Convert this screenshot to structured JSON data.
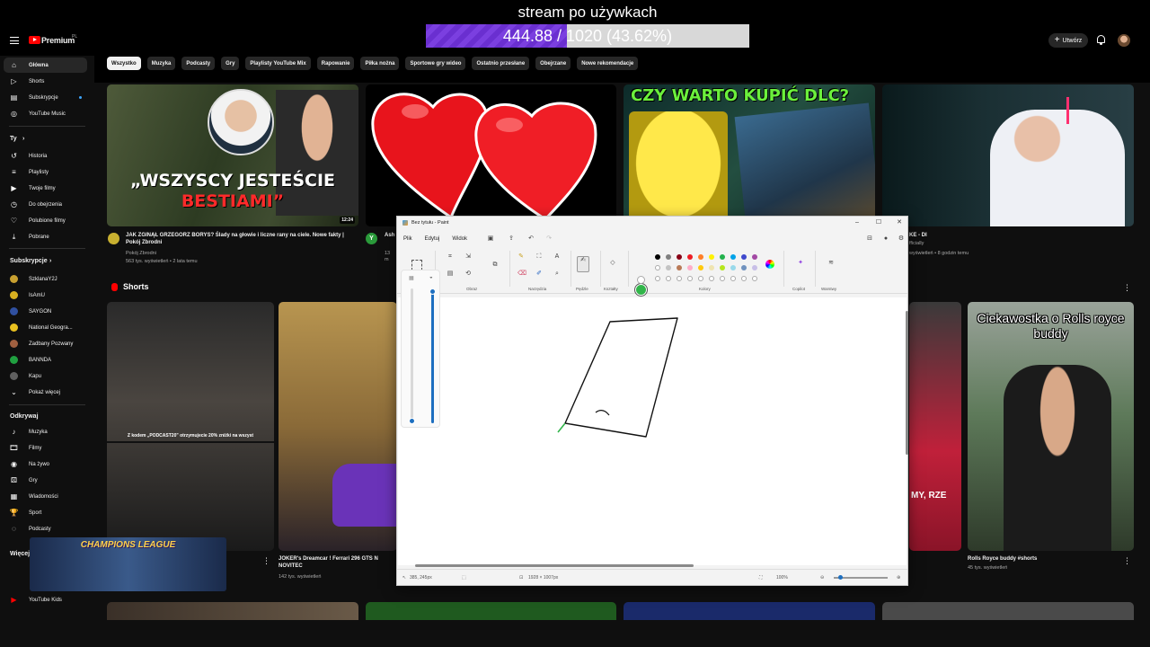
{
  "overlay": {
    "stream_title": "stream po używkach",
    "progress_text": "444.88 / 1020 (43.62%)",
    "progress_value": 444.88,
    "progress_max": 1020,
    "progress_fraction": 0.4362
  },
  "header": {
    "brand": "Premium",
    "region": "PL",
    "create_label": "Utwórz"
  },
  "chips": [
    "Wszystko",
    "Muzyka",
    "Podcasty",
    "Gry",
    "Playlisty YouTube Mix",
    "Rapowanie",
    "Piłka nożna",
    "Sportowe gry wideo",
    "Ostatnio przesłane",
    "Obejrzane",
    "Nowe rekomendacje"
  ],
  "sidebar": {
    "main": [
      {
        "label": "Główna",
        "icon": "home-icon"
      },
      {
        "label": "Shorts",
        "icon": "shorts-icon"
      },
      {
        "label": "Subskrypcje",
        "icon": "subscriptions-icon"
      },
      {
        "label": "YouTube Music",
        "icon": "youtube-music-icon"
      }
    ],
    "you_heading": "Ty",
    "you": [
      {
        "label": "Historia",
        "icon": "history-icon"
      },
      {
        "label": "Playlisty",
        "icon": "playlists-icon"
      },
      {
        "label": "Twoje filmy",
        "icon": "your-videos-icon"
      },
      {
        "label": "Do obejrzenia",
        "icon": "watch-later-icon"
      },
      {
        "label": "Polubione filmy",
        "icon": "liked-icon"
      },
      {
        "label": "Pobrane",
        "icon": "download-icon"
      }
    ],
    "subs_heading": "Subskrypcje",
    "subs": [
      {
        "label": "SzklanaY2J",
        "color": "#c8a030"
      },
      {
        "label": "IsAmU",
        "color": "#d8b020"
      },
      {
        "label": "SAYGON",
        "color": "#3050a0"
      },
      {
        "label": "National Geogra...",
        "color": "#e8c020"
      },
      {
        "label": "Zadbany Pozwany",
        "color": "#a06040"
      },
      {
        "label": "BANNDA",
        "color": "#20a040"
      },
      {
        "label": "Kapu",
        "color": "#606060"
      }
    ],
    "show_more": "Pokaż więcej",
    "explore_heading": "Odkrywaj",
    "explore": [
      {
        "label": "Muzyka",
        "icon": "music-icon"
      },
      {
        "label": "Filmy",
        "icon": "movies-icon"
      },
      {
        "label": "Na żywo",
        "icon": "live-icon"
      },
      {
        "label": "Gry",
        "icon": "gaming-icon"
      },
      {
        "label": "Wiadomości",
        "icon": "news-icon"
      },
      {
        "label": "Sport",
        "icon": "sport-icon"
      },
      {
        "label": "Podcasty",
        "icon": "podcasts-icon"
      }
    ],
    "more_heading": "Więcej",
    "youtube_kids": "YouTube Kids"
  },
  "videos": [
    {
      "thumb_caption_1": "„WSZYSCY JESTEŚCIE",
      "thumb_caption_2": "BESTIAMI”",
      "duration": "12:24",
      "title": "JAK ZGINĄŁ GRZEGORZ BORYS? Ślady na głowie i liczne rany na ciele. Nowe fakty | Pokój Zbrodni",
      "channel": "Pokój Zbrodni",
      "meta": "563 tys. wyświetleń • 2 lata temu"
    },
    {
      "channel_initial": "Y",
      "title": "Ash",
      "meta": "13 m"
    },
    {
      "thumb_caption": "CZY WARTO KUPIĆ DLC?"
    },
    {
      "title": "KE - DI",
      "channel": "fficially",
      "meta": "wyświetleń • 8 godzin temu"
    }
  ],
  "shorts": {
    "heading": "Shorts",
    "items": [
      {
        "thumb_caption": "Z kodem „PODCAST20\" otrzymujecie 20% zniżki na wszyst"
      },
      {
        "title": "JOKER's Dreamcar ! Ferrari 296 GTS N NOVITEC",
        "meta": "142 tys. wyświetleń"
      },
      {
        "thumb_caption": "MY, RZE"
      },
      {
        "thumb_caption": "Ciekawostka o Rolls royce buddy",
        "title": "Rolls Royce buddy #shorts",
        "meta": "45 tys. wyświetleń"
      }
    ]
  },
  "overlay_game": {
    "title": "CHAMPIONS LEAGUE"
  },
  "paint": {
    "window_title": "Bez tytułu - Paint",
    "menus": [
      "Plik",
      "Edytuj",
      "Widok"
    ],
    "groups": [
      "Zaznaczenie",
      "Obraz",
      "Narzędzia",
      "Pędzle",
      "Kształty",
      "Kolory",
      "Copilot",
      "Warstwy"
    ],
    "active_color": "#31b54a",
    "palette_row1": [
      "#000000",
      "#7f7f7f",
      "#880015",
      "#ed1c24",
      "#ff7f27",
      "#fff200",
      "#22b14c",
      "#00a2e8",
      "#3f48cc",
      "#a349a4"
    ],
    "palette_row2": [
      "#ffffff",
      "#c3c3c3",
      "#b97a57",
      "#ffaec9",
      "#ffc90e",
      "#efe4b0",
      "#b5e61d",
      "#99d9ea",
      "#7092be",
      "#c8bfe7"
    ],
    "status_cursor": "385, 245px",
    "status_canvas": "1928 × 1007px",
    "zoom": "100%",
    "brush_size_fraction": 0.02,
    "brush_opacity_fraction": 0.98
  }
}
